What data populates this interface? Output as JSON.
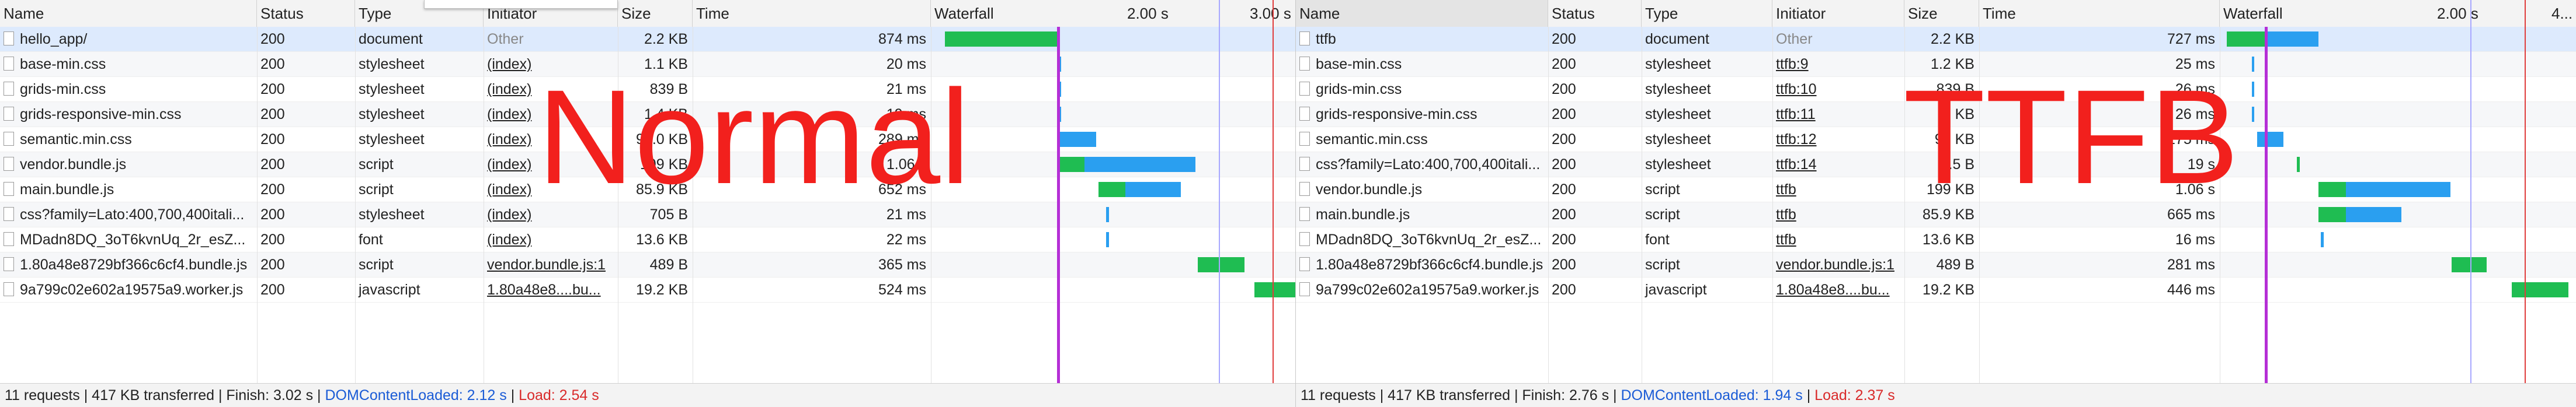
{
  "columns": {
    "name": "Name",
    "status": "Status",
    "type": "Type",
    "initiator": "Initiator",
    "size": "Size",
    "time": "Time",
    "waterfall": "Waterfall"
  },
  "panels": [
    {
      "id": "left",
      "overlay_label": "Normal",
      "waterfall_ticks": [
        "2.00 s",
        "3.00 s"
      ],
      "status": {
        "summary": "11 requests | 417 KB transferred | Finish: 3.02 s | ",
        "dcl": "DOMContentLoaded: 2.12 s",
        "sep": " | ",
        "load": "Load: 2.54 s"
      },
      "rows": [
        {
          "name": "hello_app/",
          "status": "200",
          "type": "document",
          "initiator": "Other",
          "size": "2.2 KB",
          "time": "874 ms",
          "bars": [
            {
              "kind": "wait",
              "start": 0.0,
              "end": 0.87
            }
          ]
        },
        {
          "name": "base-min.css",
          "status": "200",
          "type": "stylesheet",
          "initiator": "(index)",
          "size": "1.1 KB",
          "time": "20 ms",
          "bars": [
            {
              "kind": "recv",
              "start": 0.88,
              "end": 0.9
            }
          ]
        },
        {
          "name": "grids-min.css",
          "status": "200",
          "type": "stylesheet",
          "initiator": "(index)",
          "size": "839 B",
          "time": "21 ms",
          "bars": [
            {
              "kind": "recv",
              "start": 0.88,
              "end": 0.9
            }
          ]
        },
        {
          "name": "grids-responsive-min.css",
          "status": "200",
          "type": "stylesheet",
          "initiator": "(index)",
          "size": "1.4 KB",
          "time": "19 ms",
          "bars": [
            {
              "kind": "recv",
              "start": 0.88,
              "end": 0.9
            }
          ]
        },
        {
          "name": "semantic.min.css",
          "status": "200",
          "type": "stylesheet",
          "initiator": "(index)",
          "size": "93.0 KB",
          "time": "289 ms",
          "bars": [
            {
              "kind": "recv",
              "start": 0.88,
              "end": 1.17
            }
          ]
        },
        {
          "name": "vendor.bundle.js",
          "status": "200",
          "type": "script",
          "initiator": "(index)",
          "size": "199 KB",
          "time": "1.06 s",
          "bars": [
            {
              "kind": "wait",
              "start": 0.88,
              "end": 1.08
            },
            {
              "kind": "recv",
              "start": 1.08,
              "end": 1.94
            }
          ]
        },
        {
          "name": "main.bundle.js",
          "status": "200",
          "type": "script",
          "initiator": "(index)",
          "size": "85.9 KB",
          "time": "652 ms",
          "bars": [
            {
              "kind": "wait",
              "start": 1.19,
              "end": 1.4
            },
            {
              "kind": "recv",
              "start": 1.4,
              "end": 1.83
            }
          ]
        },
        {
          "name": "css?family=Lato:400,700,400itali...",
          "status": "200",
          "type": "stylesheet",
          "initiator": "(index)",
          "size": "705 B",
          "time": "21 ms",
          "bars": [
            {
              "kind": "recv",
              "start": 1.25,
              "end": 1.27
            }
          ]
        },
        {
          "name": "MDadn8DQ_3oT6kvnUq_2r_esZ...",
          "status": "200",
          "type": "font",
          "initiator": "(index)",
          "size": "13.6 KB",
          "time": "22 ms",
          "bars": [
            {
              "kind": "recv",
              "start": 1.25,
              "end": 1.27
            }
          ]
        },
        {
          "name": "1.80a48e8729bf366c6cf4.bundle.js",
          "status": "200",
          "type": "script",
          "initiator": "vendor.bundle.js:1",
          "size": "489 B",
          "time": "365 ms",
          "bars": [
            {
              "kind": "wait",
              "start": 1.96,
              "end": 2.32
            }
          ]
        },
        {
          "name": "9a799c02e602a19575a9.worker.js",
          "status": "200",
          "type": "javascript",
          "initiator": "1.80a48e8....bu...",
          "size": "19.2 KB",
          "time": "524 ms",
          "bars": [
            {
              "kind": "wait",
              "start": 2.4,
              "end": 2.92
            }
          ]
        }
      ]
    },
    {
      "id": "right",
      "overlay_label": "TTFB",
      "waterfall_ticks": [
        "2.00 s",
        "4..."
      ],
      "status": {
        "summary": "11 requests | 417 KB transferred | Finish: 2.76 s | ",
        "dcl": "DOMContentLoaded: 1.94 s",
        "sep": " | ",
        "load": "Load: 2.37 s"
      },
      "rows": [
        {
          "name": "ttfb",
          "status": "200",
          "type": "document",
          "initiator": "Other",
          "size": "2.2 KB",
          "time": "727 ms",
          "bars": [
            {
              "kind": "wait",
              "start": 0.0,
              "end": 0.3
            },
            {
              "kind": "recv",
              "start": 0.3,
              "end": 0.73
            }
          ]
        },
        {
          "name": "base-min.css",
          "status": "200",
          "type": "stylesheet",
          "initiator": "ttfb:9",
          "size": "1.2 KB",
          "time": "25 ms",
          "bars": [
            {
              "kind": "recv",
              "start": 0.2,
              "end": 0.22
            }
          ]
        },
        {
          "name": "grids-min.css",
          "status": "200",
          "type": "stylesheet",
          "initiator": "ttfb:10",
          "size": "839 B",
          "time": "26 ms",
          "bars": [
            {
              "kind": "recv",
              "start": 0.2,
              "end": 0.22
            }
          ]
        },
        {
          "name": "grids-responsive-min.css",
          "status": "200",
          "type": "stylesheet",
          "initiator": "ttfb:11",
          "size": "1 KB",
          "time": "26 ms",
          "bars": [
            {
              "kind": "recv",
              "start": 0.2,
              "end": 0.22
            }
          ]
        },
        {
          "name": "semantic.min.css",
          "status": "200",
          "type": "stylesheet",
          "initiator": "ttfb:12",
          "size": "93 KB",
          "time": "275 ms",
          "bars": [
            {
              "kind": "recv",
              "start": 0.24,
              "end": 0.45
            }
          ]
        },
        {
          "name": "css?family=Lato:400,700,400itali...",
          "status": "200",
          "type": "stylesheet",
          "initiator": "ttfb:14",
          "size": "7.5 B",
          "time": "19 s",
          "bars": [
            {
              "kind": "wait",
              "start": 0.56,
              "end": 0.58
            }
          ]
        },
        {
          "name": "vendor.bundle.js",
          "status": "200",
          "type": "script",
          "initiator": "ttfb",
          "size": "199 KB",
          "time": "1.06 s",
          "bars": [
            {
              "kind": "wait",
              "start": 0.73,
              "end": 0.95
            },
            {
              "kind": "recv",
              "start": 0.95,
              "end": 1.78
            }
          ]
        },
        {
          "name": "main.bundle.js",
          "status": "200",
          "type": "script",
          "initiator": "ttfb",
          "size": "85.9 KB",
          "time": "665 ms",
          "bars": [
            {
              "kind": "wait",
              "start": 0.73,
              "end": 0.95
            },
            {
              "kind": "recv",
              "start": 0.95,
              "end": 1.39
            }
          ]
        },
        {
          "name": "MDadn8DQ_3oT6kvnUq_2r_esZ...",
          "status": "200",
          "type": "font",
          "initiator": "ttfb",
          "size": "13.6 KB",
          "time": "16 ms",
          "bars": [
            {
              "kind": "recv",
              "start": 0.75,
              "end": 0.77
            }
          ]
        },
        {
          "name": "1.80a48e8729bf366c6cf4.bundle.js",
          "status": "200",
          "type": "script",
          "initiator": "vendor.bundle.js:1",
          "size": "489 B",
          "time": "281 ms",
          "bars": [
            {
              "kind": "wait",
              "start": 1.79,
              "end": 2.07
            }
          ]
        },
        {
          "name": "9a799c02e602a19575a9.worker.js",
          "status": "200",
          "type": "javascript",
          "initiator": "1.80a48e8....bu...",
          "size": "19.2 KB",
          "time": "446 ms",
          "bars": [
            {
              "kind": "wait",
              "start": 2.27,
              "end": 2.72
            }
          ]
        }
      ]
    }
  ],
  "colors": {
    "wait": "#1fbd52",
    "recv": "#2a9ff0",
    "dcl_line": "#a8a8ff",
    "load_line": "#e03c3c",
    "first_paint_line": "#b52fd6",
    "overlay_text": "#f2201d"
  },
  "waterfall_markers": {
    "left": {
      "paint": 0.87,
      "dcl": 2.12,
      "load": 2.54
    },
    "right": {
      "paint": 0.3,
      "dcl": 1.94,
      "load": 2.37
    }
  }
}
